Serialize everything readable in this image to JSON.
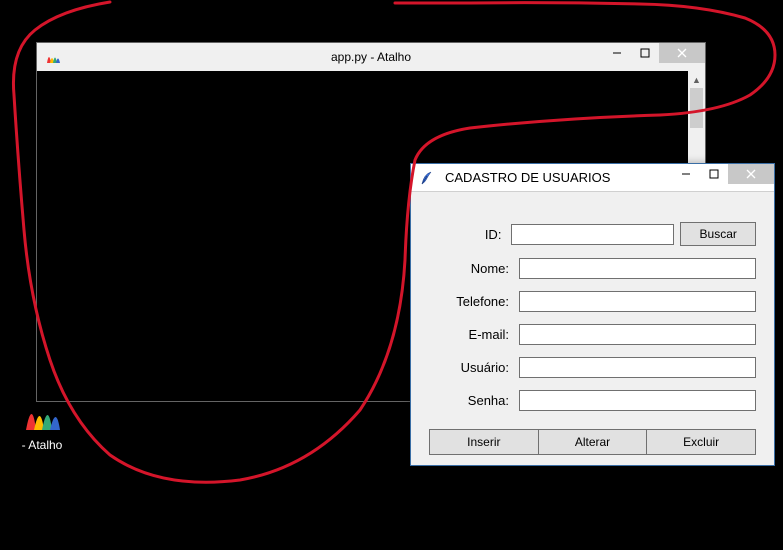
{
  "console": {
    "title": "app.py - Atalho",
    "icon_name": "app-icon"
  },
  "desktop_icon": {
    "label": "- Atalho"
  },
  "dialog": {
    "title": "CADASTRO DE USUARIOS",
    "fields": {
      "id": {
        "label": "ID:",
        "value": ""
      },
      "nome": {
        "label": "Nome:",
        "value": ""
      },
      "telefone": {
        "label": "Telefone:",
        "value": ""
      },
      "email": {
        "label": "E-mail:",
        "value": ""
      },
      "usuario": {
        "label": "Usuário:",
        "value": ""
      },
      "senha": {
        "label": "Senha:",
        "value": ""
      }
    },
    "buttons": {
      "buscar": "Buscar",
      "inserir": "Inserir",
      "alterar": "Alterar",
      "excluir": "Excluir"
    }
  },
  "win_controls": {
    "minimize": "—",
    "maximize": "◻",
    "close": "✕"
  }
}
